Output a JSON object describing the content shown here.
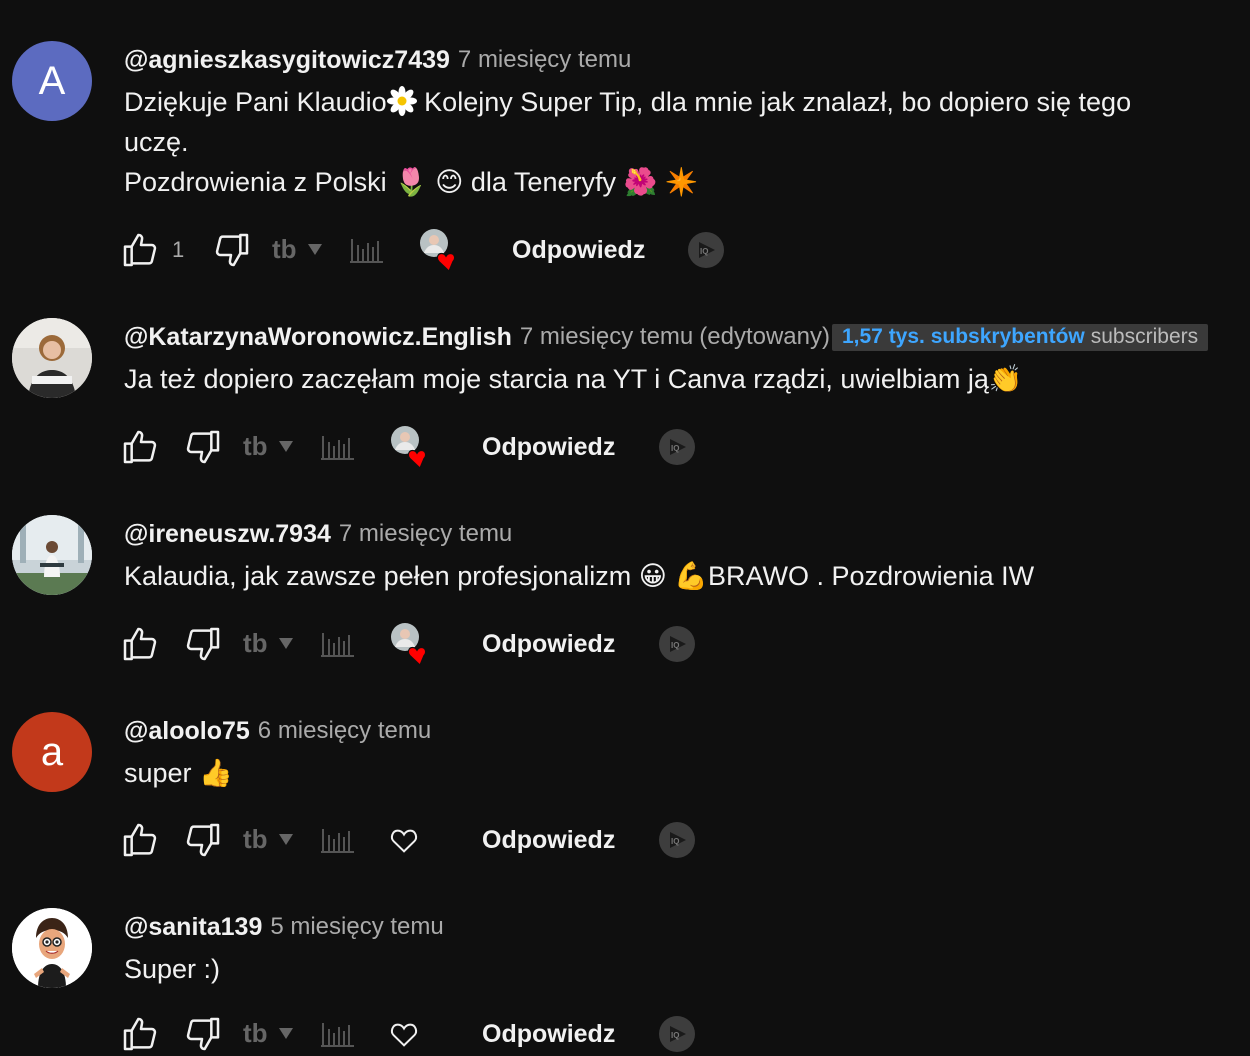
{
  "comments": [
    {
      "author": "@agnieszkasygitowicz7439",
      "time": "7 miesięcy temu",
      "avatar_letter": "A",
      "avatar_color": "#5c6bc0",
      "lines": [
        "Dziękuje Pani Klaudio",
        " Kolejny Super Tip, dla mnie jak znalazł, bo dopiero się tego uczę.",
        "Pozdrowienia z Polski 🌷 😊 dla Teneryfy 🌺 ✴️"
      ],
      "like_count": "1",
      "reply_label": "Odpowiedz",
      "hearted": true
    },
    {
      "author": "@KatarzynaWoronowicz.English",
      "time": "7 miesięcy temu",
      "edited": "(edytowany)",
      "subscriber_count": "1,57 tys. subskrybentów",
      "subscriber_label": "subscribers",
      "text": "Ja też dopiero zaczęłam moje starcia na YT i Canva rządzi, uwielbiam ją👏",
      "like_count": "",
      "reply_label": "Odpowiedz",
      "hearted": true
    },
    {
      "author": "@ireneuszw.7934",
      "time": "7 miesięcy temu",
      "text": "Kalaudia, jak zawsze pełen profesjonalizm 😀 💪BRAWO . Pozdrowienia IW",
      "like_count": "",
      "reply_label": "Odpowiedz",
      "hearted": true
    },
    {
      "author": "@aloolo75",
      "time": "6 miesięcy temu",
      "avatar_letter": "a",
      "avatar_color": "#c2391b",
      "text": "super 👍",
      "like_count": "",
      "reply_label": "Odpowiedz",
      "hearted": false
    },
    {
      "author": "@sanita139",
      "time": "5 miesięcy temu",
      "text": "Super :)",
      "like_count": "",
      "reply_label": "Odpowiedz",
      "hearted": false
    }
  ],
  "icons": {
    "like": "thumbs-up-icon",
    "dislike": "thumbs-down-icon",
    "tubebuddy": "tubebuddy-icon",
    "stats": "bar-chart-icon",
    "heart": "heart-icon",
    "creator_heart": "creator-heart-icon",
    "extension": "play-badge-icon"
  },
  "colors": {
    "background": "#0f0f0f",
    "link": "#3ea6ff",
    "heart": "#ff0000"
  }
}
